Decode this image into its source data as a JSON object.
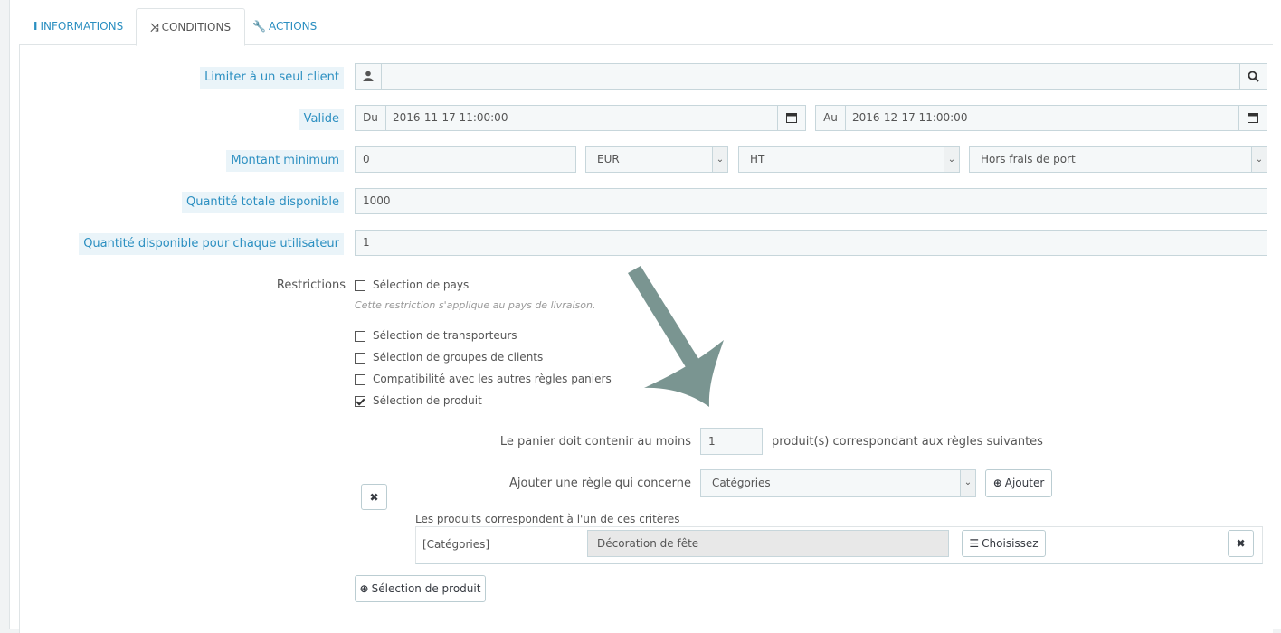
{
  "tabs": [
    {
      "label": "INFORMATIONS",
      "icon": "info-icon",
      "active": false
    },
    {
      "label": "CONDITIONS",
      "icon": "shuffle-icon",
      "active": true
    },
    {
      "label": "ACTIONS",
      "icon": "wrench-icon",
      "active": false
    }
  ],
  "form": {
    "client": {
      "label": "Limiter à un seul client",
      "value": ""
    },
    "validity": {
      "label": "Valide",
      "from_label": "Du",
      "from_value": "2016-11-17 11:00:00",
      "to_label": "Au",
      "to_value": "2016-12-17 11:00:00"
    },
    "minimum": {
      "label": "Montant minimum",
      "value": "0",
      "currency": "EUR",
      "tax": "HT",
      "shipping": "Hors frais de port"
    },
    "total_quantity": {
      "label": "Quantité totale disponible",
      "value": "1000"
    },
    "user_quantity": {
      "label": "Quantité disponible pour chaque utilisateur",
      "value": "1"
    },
    "restrictions": {
      "label": "Restrictions",
      "country": {
        "label": "Sélection de pays",
        "checked": false,
        "hint": "Cette restriction s'applique au pays de livraison."
      },
      "carriers": {
        "label": "Sélection de transporteurs",
        "checked": false
      },
      "groups": {
        "label": "Sélection de groupes de clients",
        "checked": false
      },
      "compat": {
        "label": "Compatibilité avec les autres règles paniers",
        "checked": false
      },
      "products": {
        "label": "Sélection de produit",
        "checked": true
      }
    },
    "product_rule": {
      "min_label": "Le panier doit contenir au moins",
      "min_value": "1",
      "min_suffix": "produit(s) correspondant aux règles suivantes",
      "add_rule_label": "Ajouter une règle qui concerne",
      "add_rule_value": "Catégories",
      "add_button": "Ajouter",
      "criteria_label": "Les produits correspondent à l'un de ces critères",
      "criteria_type": "[Catégories]",
      "criteria_value": "Décoration de fête",
      "choose_button": "Choisissez",
      "product_selection_button": "Sélection de produit"
    }
  },
  "colors": {
    "accent": "#2b8fc1",
    "arrow": "#7a9591"
  }
}
